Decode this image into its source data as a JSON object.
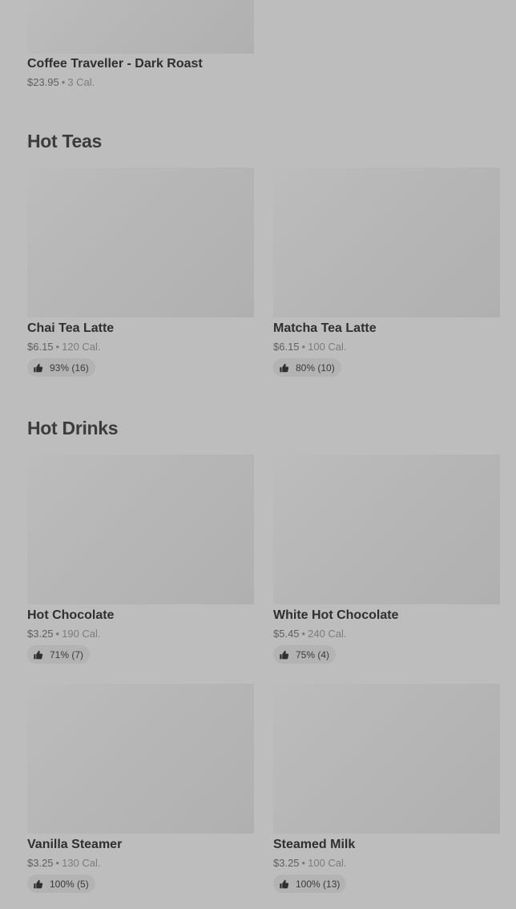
{
  "sections": [
    {
      "title": "",
      "items": [
        {
          "name": "Coffee Traveller - Dark Roast",
          "price": "$23.95",
          "calories": "3 Cal.",
          "rating": null
        }
      ]
    },
    {
      "title": "Hot Teas",
      "items": [
        {
          "name": "Chai Tea Latte",
          "price": "$6.15",
          "calories": "120 Cal.",
          "rating": "93% (16)"
        },
        {
          "name": "Matcha Tea Latte",
          "price": "$6.15",
          "calories": "100 Cal.",
          "rating": "80% (10)"
        }
      ]
    },
    {
      "title": "Hot Drinks",
      "items": [
        {
          "name": "Hot Chocolate",
          "price": "$3.25",
          "calories": "190 Cal.",
          "rating": "71% (7)"
        },
        {
          "name": "White Hot Chocolate",
          "price": "$5.45",
          "calories": "240 Cal.",
          "rating": "75% (4)"
        },
        {
          "name": "Vanilla Steamer",
          "price": "$3.25",
          "calories": "130 Cal.",
          "rating": "100% (5)"
        },
        {
          "name": "Steamed Milk",
          "price": "$3.25",
          "calories": "100 Cal.",
          "rating": "100% (13)"
        }
      ]
    }
  ],
  "meta_separator": "•",
  "icons": {
    "rating": "thumbs-up-icon",
    "image": "image-placeholder"
  }
}
